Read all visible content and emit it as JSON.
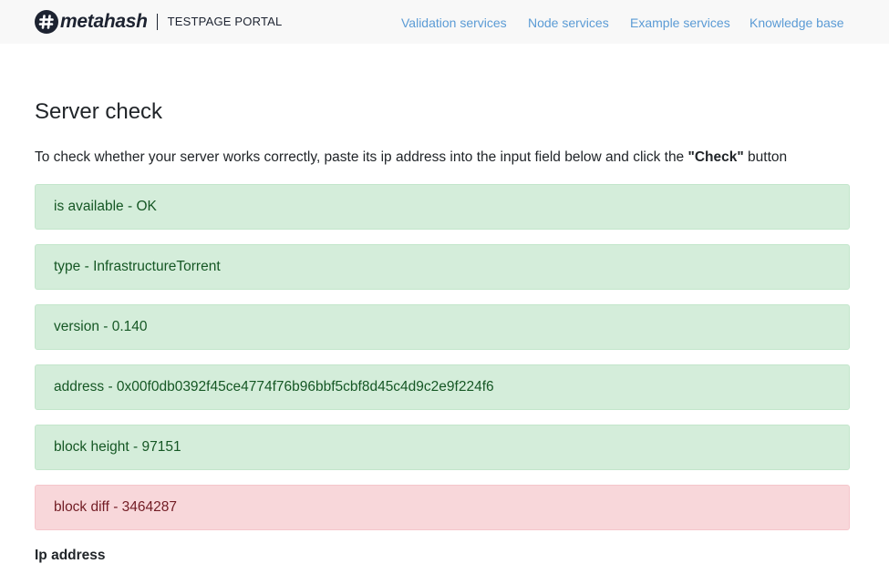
{
  "header": {
    "brand": "metahash",
    "portal": "TESTPAGE PORTAL",
    "nav": [
      {
        "label": "Validation services"
      },
      {
        "label": "Node services"
      },
      {
        "label": "Example services"
      },
      {
        "label": "Knowledge base"
      }
    ]
  },
  "main": {
    "title": "Server check",
    "intro_before": "To check whether your server works correctly, paste its ip address into the input field below and click the ",
    "intro_button": "\"Check\"",
    "intro_after": " button",
    "results": [
      {
        "text": "is available - OK",
        "status": "ok"
      },
      {
        "text": "type - InfrastructureTorrent",
        "status": "ok"
      },
      {
        "text": "version - 0.140",
        "status": "ok"
      },
      {
        "text": "address - 0x00f0db0392f45ce4774f76b96bbf5cbf8d45c4d9c2e9f224f6",
        "status": "ok"
      },
      {
        "text": "block height - 97151",
        "status": "ok"
      },
      {
        "text": "block diff - 3464287",
        "status": "error"
      }
    ],
    "ip_label": "Ip address"
  },
  "colors": {
    "nav_link": "#5b9bd5",
    "ok_bg": "#d4edda",
    "ok_text": "#155724",
    "error_bg": "#f8d7da",
    "error_text": "#721c24"
  },
  "icons": {
    "logo": "hash-logo-icon"
  }
}
